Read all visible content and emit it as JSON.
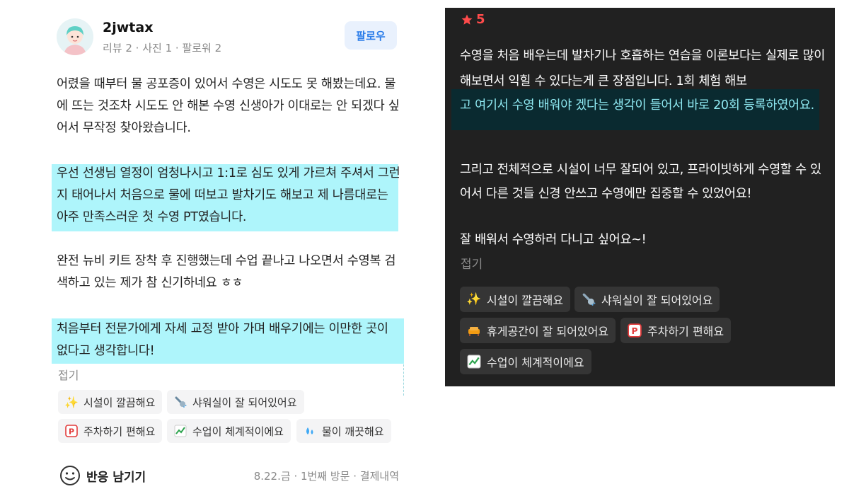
{
  "left_review": {
    "user": {
      "name": "2jwtax",
      "stats": "리뷰 2 · 사진 1 · 팔로워 2"
    },
    "follow_label": "팔로우",
    "paragraphs": {
      "p1": "어렸을 때부터 물 공포증이 있어서 수영은 시도도 못 해봤는데요. 물에 뜨는 것조차 시도도 안 해본 수영 신생아가 이대로는 안 되겠다 싶어서 무작정 찾아왔습니다.",
      "p2": "우선 선생님 열정이 엄청나시고 1:1로 심도 있게 가르쳐 주셔서 그런지 태어나서 처음으로 물에 떠보고 발차기도 해보고 제 나름대로는 아주 만족스러운 첫 수영 PT였습니다.",
      "p3": "완전 뉴비 키트 장착 후 진행했는데 수업 끝나고 나오면서 수영복 검색하고 있는 제가 참 신기하네요 ㅎㅎ",
      "p4": "처음부터 전문가에게 자세 교정 받아 가며 배우기에는 이만한 곳이 없다고 생각합니다!"
    },
    "fold_label": "접기",
    "keywords": [
      {
        "label": "시설이 깔끔해요",
        "icon": "sparkles-icon"
      },
      {
        "label": "샤워실이 잘 되어있어요",
        "icon": "shower-icon"
      },
      {
        "label": "주차하기 편해요",
        "icon": "parking-icon"
      },
      {
        "label": "수업이 체계적이에요",
        "icon": "chart-up-icon"
      },
      {
        "label": "물이 깨끗해요",
        "icon": "droplets-icon"
      }
    ],
    "react_label": "반응 남기기",
    "visit_meta": "8.22.금 · 1번째 방문 · 결제내역"
  },
  "right_review": {
    "rating": "5",
    "paragraphs": {
      "p1a": "수영을 처음 배우는데 발차기나 호흡하는 연습을 이론보다는 실제로 많이 해보면서 익힐 수 있다는게 큰 장점입니다. 1회 체험 해보",
      "p1b": "고 여기서 수영 배워야 겠다는 생각이 들어서 바로 20회 등록하였어요.",
      "p2": "그리고 전체적으로 시설이 너무 잘되어 있고, 프라이빗하게 수영할 수 있어서 다른 것들 신경 안쓰고 수영에만 집중할 수 있었어요!",
      "p3": "잘 배워서 수영하러 다니고 싶어요~!"
    },
    "fold_label": "접기",
    "keywords": [
      {
        "label": "시설이 깔끔해요",
        "icon": "sparkles-icon"
      },
      {
        "label": "샤워실이 잘 되어있어요",
        "icon": "shower-icon"
      },
      {
        "label": "휴게공간이 잘 되어있어요",
        "icon": "sofa-icon"
      },
      {
        "label": "주차하기 편해요",
        "icon": "parking-icon"
      },
      {
        "label": "수업이 체계적이에요",
        "icon": "chart-up-icon"
      }
    ]
  },
  "colors": {
    "highlight_light": "#aef5fb",
    "highlight_dark_text": "#8fe9f2",
    "follow_text": "#2b7de9",
    "rating_red": "#ff4b4b",
    "dark_bg": "#212121"
  }
}
